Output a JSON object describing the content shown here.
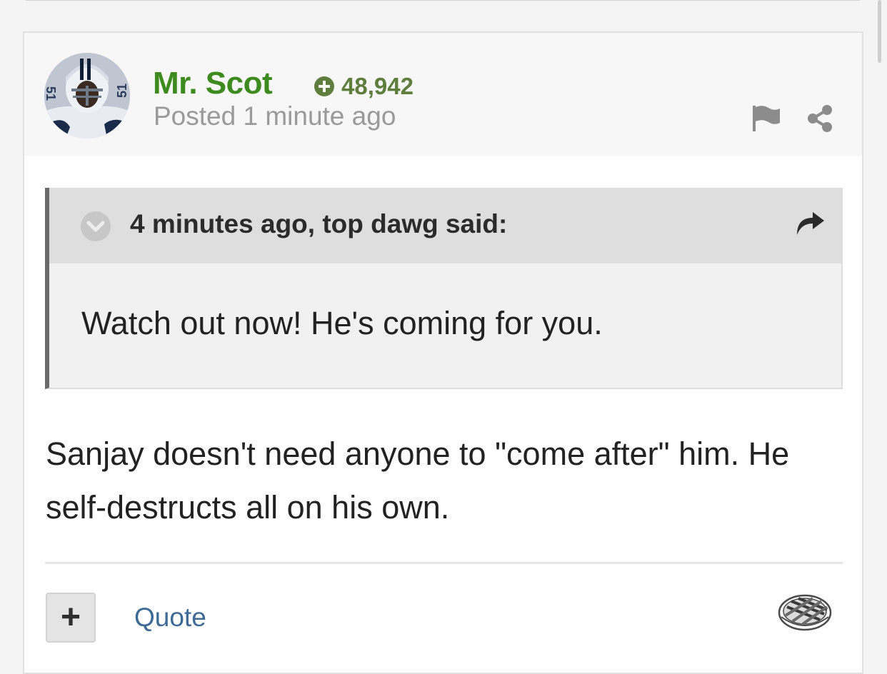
{
  "post": {
    "author": {
      "name": "Mr. Scot",
      "reputation": "48,942",
      "avatar_icon": "player-avatar"
    },
    "posted": "Posted 1 minute ago",
    "header_icons": [
      "flag-icon",
      "share-icon"
    ],
    "quote": {
      "citation": "4 minutes ago, top dawg said:",
      "text": "Watch out now! He's coming for you."
    },
    "body": "Sanjay doesn't need anyone to \"come after\" him. He self-destructs all on his own.",
    "footer": {
      "plus_label": "+",
      "quote_label": "Quote",
      "reaction_icon": "pie-icon"
    }
  },
  "colors": {
    "author_green": "#3d8b1f",
    "reputation_green": "#5f7d3d",
    "link_blue": "#3e6b96",
    "muted_gray": "#9a9a9a"
  }
}
